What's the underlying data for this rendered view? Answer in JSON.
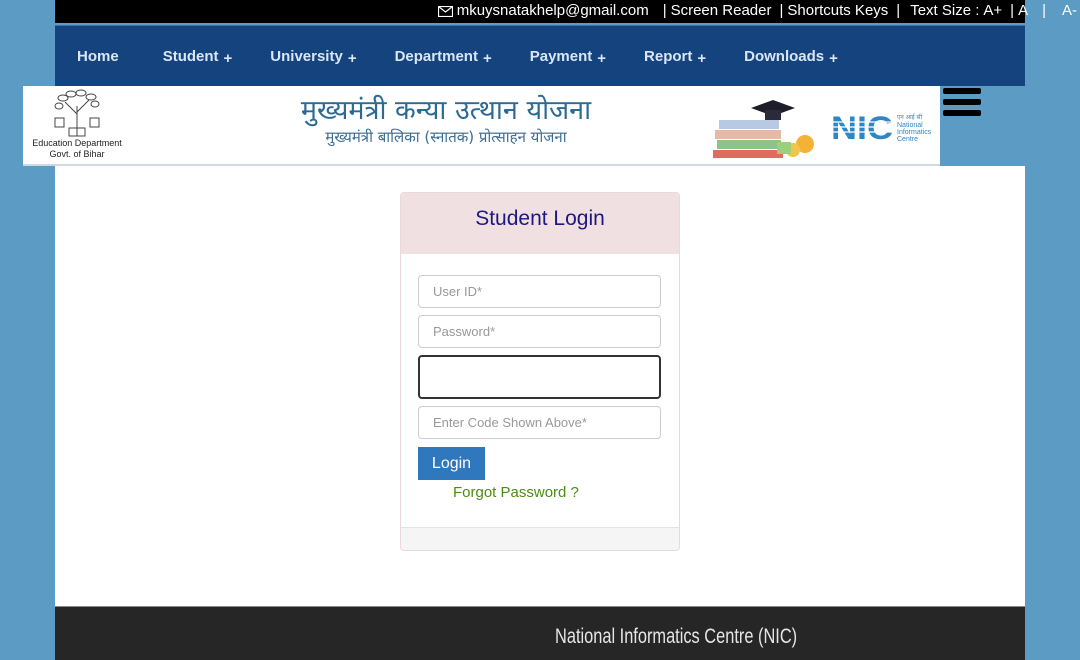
{
  "topbar": {
    "email": "mkuysnatakhelp@gmail.com",
    "screen_reader": "Screen Reader",
    "shortcuts": "Shortcuts Keys",
    "text_size_label": "Text Size :",
    "text_size_increase": "A+",
    "text_size_normal": "A",
    "text_size_decrease": "A-",
    "separator": "|"
  },
  "nav": {
    "items": [
      {
        "label": "Home",
        "has_submenu": false
      },
      {
        "label": "Student",
        "has_submenu": true
      },
      {
        "label": "University",
        "has_submenu": true
      },
      {
        "label": "Department",
        "has_submenu": true
      },
      {
        "label": "Payment",
        "has_submenu": true
      },
      {
        "label": "Report",
        "has_submenu": true
      },
      {
        "label": "Downloads",
        "has_submenu": true
      }
    ],
    "submenu_glyph": "+"
  },
  "banner": {
    "dept_line1": "Education Department",
    "dept_line2": "Govt. of Bihar",
    "title_hindi": "मुख्यमंत्री कन्या उत्थान योजना",
    "subtitle_hindi": "मुख्यमंत्री बालिका (स्नातक) प्रोत्साहन योजना",
    "nic_short": "NIC",
    "nic_hindi": "एन आई सी",
    "nic_line1": "National",
    "nic_line2": "Informatics",
    "nic_line3": "Centre"
  },
  "login": {
    "title": "Student Login",
    "user_id_placeholder": "User ID*",
    "user_id_value": "",
    "password_placeholder": "Password*",
    "password_value": "",
    "captcha_code_placeholder": "Enter Code Shown Above*",
    "captcha_code_value": "",
    "login_button": "Login",
    "forgot_password": "Forgot Password ?"
  },
  "footer": {
    "text": "National Informatics Centre (NIC)"
  },
  "colors": {
    "page_bg": "#5b9bc4",
    "nav_bg": "#14437e",
    "login_button": "#2f78bd",
    "card_header": "#f1e0e1",
    "forgot_link": "#4c8c14",
    "footer_bg": "#262626"
  }
}
